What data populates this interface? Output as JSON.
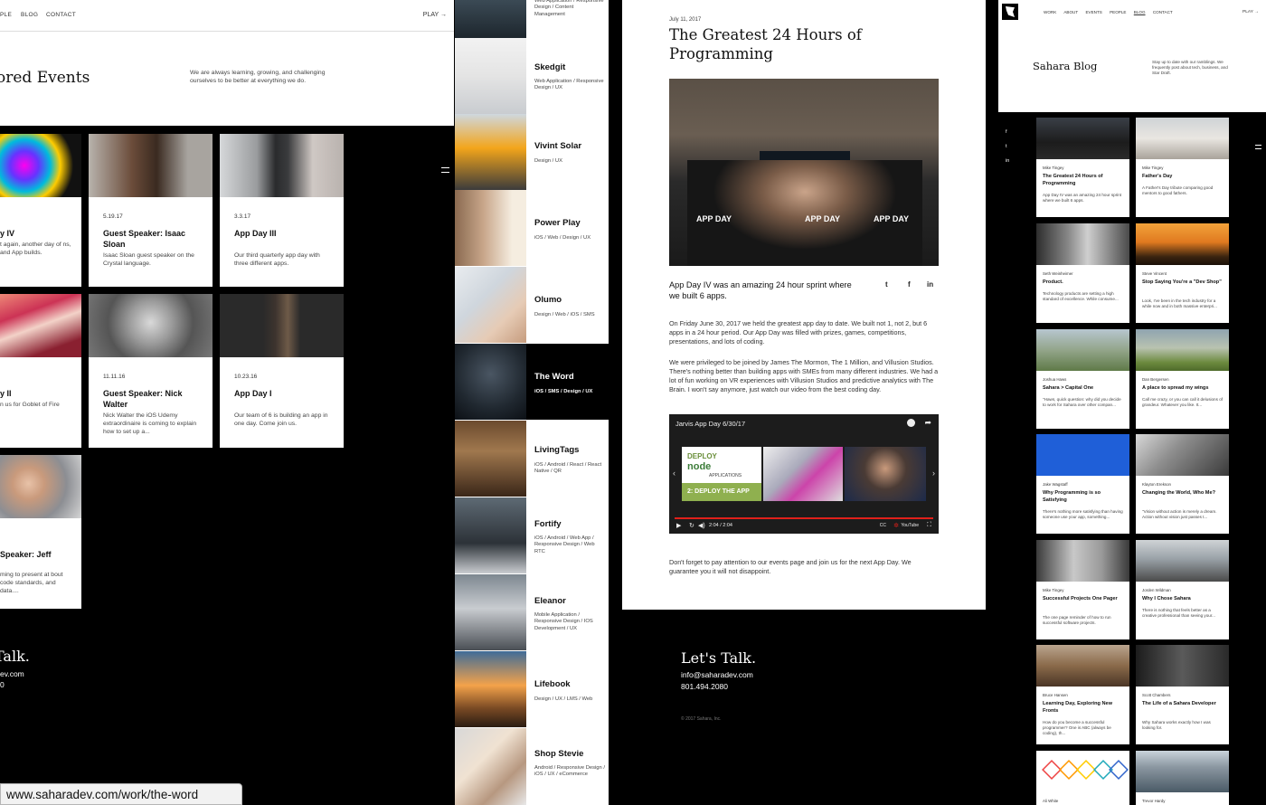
{
  "events_panel": {
    "nav": [
      "PLE",
      "BLOG",
      "CONTACT"
    ],
    "play_label": "PLAY",
    "title": "ored Events",
    "intro": "We are always learning, growing, and challenging ourselves to be better at everything we do.",
    "cards": [
      {
        "date": "",
        "title": "y IV",
        "desc": "t again, another day of ns, and App builds."
      },
      {
        "date": "5.19.17",
        "title": "Guest Speaker: Isaac Sloan",
        "desc": "Isaac Sloan guest speaker on the Crystal language."
      },
      {
        "date": "3.3.17",
        "title": "App Day III",
        "desc": "Our third quarterly app day with three different apps."
      },
      {
        "date": "",
        "title": "y II",
        "desc": "n us for Goblet of Fire"
      },
      {
        "date": "11.11.16",
        "title": "Guest Speaker: Nick Walter",
        "desc": "Nick Walter the iOS Udemy extraordinaire is coming to explain how to set up a..."
      },
      {
        "date": "10.23.16",
        "title": "App Day I",
        "desc": "Our team of 6 is building an app in one day. Come join us."
      },
      {
        "date": "",
        "title": "Speaker: Jeff",
        "desc": "ming to present at bout code standards, and data...."
      }
    ],
    "talk_title": "Talk.",
    "talk_email": "ev.com",
    "talk_phone": "0"
  },
  "status_url": "www.saharadev.com/work/the-word",
  "work_panel": {
    "top_subtitle": "Web Application / Responsive Design / Content Management",
    "items": [
      {
        "title": "Skedgit",
        "sub": "Web Application / Responsive Design / UX"
      },
      {
        "title": "Vivint Solar",
        "sub": "Design / UX"
      },
      {
        "title": "Power Play",
        "sub": "iOS / Web / Design / UX"
      },
      {
        "title": "Olumo",
        "sub": "Design / Web / iOS / SMS"
      },
      {
        "title": "The Word",
        "sub": "iOS / SMS / Design / UX"
      },
      {
        "title": "LivingTags",
        "sub": "iOS / Android / React / React Native / QR"
      },
      {
        "title": "Fortify",
        "sub": "iOS / Android / Web App / Responsive Design / Web RTC"
      },
      {
        "title": "Eleanor",
        "sub": "Mobile Application / Responsive Design / IOS Development / UX"
      },
      {
        "title": "Lifebook",
        "sub": "Design / UX / LMS / Web"
      },
      {
        "title": "Shop Stevie",
        "sub": "Android / Responsive Design / iOS / UX / eCommerce"
      }
    ]
  },
  "post_panel": {
    "date": "July 11, 2017",
    "title": "The Greatest 24 Hours of Programming",
    "photo_shirt_text": "APP DAY",
    "lead": "App Day IV was an amazing 24 hour sprint where we built 6 apps.",
    "social": [
      "t",
      "f",
      "in"
    ],
    "para1": "On Friday June 30, 2017 we held the greatest app day to date.  We built not 1, not 2, but 6 apps in a 24 hour period.  Our App Day was filled with prizes, games, competitions, presentations, and lots of coding.",
    "para2": "We were privileged to be joined by James The Mormon, The 1 Million, and Villusion Studios.  There's nothing better than building apps with SMEs from many different industries.  We had a lot of fun working on VR experiences with Villusion Studios and predictive analytics with The Brain.  I won't say anymore, just watch our video from the best coding day.",
    "video": {
      "title": "Jarvis App Day 6/30/17",
      "time": "2:04 / 2:04",
      "slide_deploy": "DEPLOY",
      "slide_node": "node",
      "slide_applications": "APPLICATIONS",
      "slide_caption": "2: DEPLOY THE APP",
      "cc": "CC",
      "youtube": "YouTube"
    },
    "outro": "Don't forget to pay attention to our events page and join us for the next App Day.  We guarantee you it will not disappoint.",
    "talk_title": "Let's Talk.",
    "talk_email": "info@saharadev.com",
    "talk_phone": "801.494.2080",
    "copyright": "© 2017 Sahara, Inc."
  },
  "blog_panel": {
    "nav": [
      "WORK",
      "ABOUT",
      "EVENTS",
      "PEOPLE",
      "BLOG",
      "CONTACT"
    ],
    "play_label": "PLAY",
    "title": "Sahara Blog",
    "intro": "Stay up to date with our ramblings. We frequently post about tech, business, and Star Draft.",
    "social": [
      "f",
      "t",
      "in"
    ],
    "posts": [
      {
        "author": "Mike Tingey",
        "title": "The Greatest 24 Hours of Programming",
        "desc": "App Day IV was an amazing 24 hour sprint where we built 6 apps."
      },
      {
        "author": "Mike Tingey",
        "title": "Father's Day",
        "desc": "A Father's Day tribute comparing good mentors to good fathers."
      },
      {
        "author": "Seth Weinheimer",
        "title": "Product.",
        "desc": "Technology products are setting a high standard of excellence. While consume..."
      },
      {
        "author": "Steve Vincent",
        "title": "Stop Saying You're a \"Dev Shop\"",
        "desc": "Look, I've been in the tech industry for a while now and in both massive enterpri..."
      },
      {
        "author": "Joshua Haws",
        "title": "Sahara > Capital One",
        "desc": "\"Haws, quick question: why did you decide to work for Sahara over other compan..."
      },
      {
        "author": "Dan Bergersen",
        "title": "A place to spread my wings",
        "desc": "Call me crazy, or you can call it delusions of grandeur. Whatever you like. It..."
      },
      {
        "author": "Jake Wagstaff",
        "title": "Why Programming is so Satisfying",
        "desc": "There's nothing more satisfying than having someone use your app, something..."
      },
      {
        "author": "Klayton Erekson",
        "title": "Changing the World, Who Me?",
        "desc": "\"Vision without action is merely a dream. Action without vision just passes t..."
      },
      {
        "author": "Mike Tingey",
        "title": "Successful Projects One Pager",
        "desc": "The one page reminder of how to run successful software projects."
      },
      {
        "author": "Jorden Wildman",
        "title": "Why I Chose Sahara",
        "desc": "There is nothing that feels better as a creative professional than seeing your..."
      },
      {
        "author": "Bruce Hansen",
        "title": "Learning Day, Exploring New Fronts",
        "desc": "How do you become a successful programmer? One is ABC (always be coding), th..."
      },
      {
        "author": "Scott Chambers",
        "title": "The Life of a Sahara Developer",
        "desc": "Why Sahara works exactly how I was looking for."
      },
      {
        "author": "Ali White",
        "title": "",
        "desc": ""
      },
      {
        "author": "Trevor Hardy",
        "title": "",
        "desc": ""
      }
    ]
  }
}
